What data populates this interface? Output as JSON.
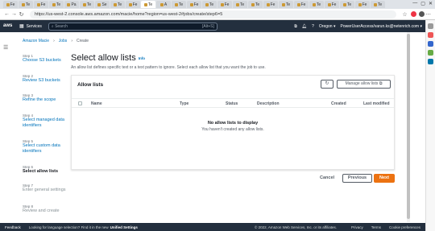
{
  "browser": {
    "url": "https://us-west-2.console.aws.amazon.com/macie/home?region=us-west-2#jobs/create/step6=5",
    "tabs": [
      "Fe",
      "Te",
      "Fe",
      "Te",
      "Pa",
      "Te",
      "Se",
      "Te",
      "Fe",
      "Te",
      "A",
      "Te",
      "Fe",
      "Te",
      "Fe",
      "Te",
      "Te",
      "Fe",
      "Te",
      "Fe",
      "Te",
      "Fe",
      "Te",
      "Fe",
      "Te"
    ]
  },
  "aws_header": {
    "logo": "aws",
    "services": "Services",
    "search_placeholder": "Search",
    "search_shortcut": "[Alt+S]",
    "region": "Oregon ▾",
    "account": "PowerUserAccess/varun.ks@netenrich.com ▾"
  },
  "breadcrumb": [
    "Amazon Macie",
    "Jobs",
    "Create"
  ],
  "steps": [
    {
      "num": "Step 1",
      "label": "Choose S3 buckets",
      "state": "link"
    },
    {
      "num": "Step 2",
      "label": "Review S3 buckets",
      "state": "link"
    },
    {
      "num": "Step 3",
      "label": "Refine the scope",
      "state": "link"
    },
    {
      "num": "Step 4",
      "label": "Select managed data identifiers",
      "state": "link"
    },
    {
      "num": "Step 5",
      "label": "Select custom data identifiers",
      "state": "link"
    },
    {
      "num": "Step 6",
      "label": "Select allow lists",
      "state": "current"
    },
    {
      "num": "Step 7",
      "label": "Enter general settings",
      "state": "disabled"
    },
    {
      "num": "Step 8",
      "label": "Review and create",
      "state": "disabled"
    }
  ],
  "main": {
    "title": "Select allow lists",
    "info": "Info",
    "description": "An allow list defines specific text or a text pattern to ignore. Select each allow list that you want the job to use."
  },
  "panel": {
    "title": "Allow lists",
    "manage_label": "Manage allow lists",
    "columns": [
      "Name",
      "Type",
      "Status",
      "Description",
      "Created",
      "Last modified"
    ],
    "empty_title": "No allow lists to display",
    "empty_sub": "You haven't created any allow lists."
  },
  "actions": {
    "cancel": "Cancel",
    "previous": "Previous",
    "next": "Next"
  },
  "footer": {
    "feedback": "Feedback",
    "language_note": "Looking for language selection? Find it in the new",
    "unified_settings": "Unified Settings",
    "copyright": "© 2022, Amazon Web Services, Inc. or its affiliates.",
    "privacy": "Privacy",
    "terms": "Terms",
    "cookie": "Cookie preferences"
  },
  "colors": {
    "aws_nav": "#232f3e",
    "primary": "#ec7211",
    "link": "#0073bb"
  }
}
